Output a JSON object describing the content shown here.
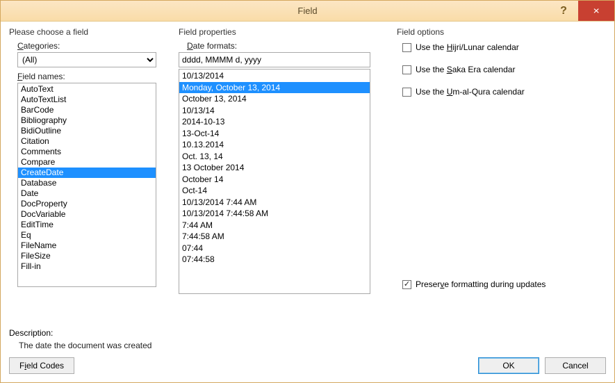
{
  "window": {
    "title": "Field"
  },
  "left": {
    "group_label": "Please choose a field",
    "categories_label_pre": "",
    "categories_label": "Categories:",
    "categories_accel": "C",
    "category_selected": "(All)",
    "fieldnames_label": "Field names:",
    "fieldnames_accel": "F",
    "field_names": [
      "AutoText",
      "AutoTextList",
      "BarCode",
      "Bibliography",
      "BidiOutline",
      "Citation",
      "Comments",
      "Compare",
      "CreateDate",
      "Database",
      "Date",
      "DocProperty",
      "DocVariable",
      "EditTime",
      "Eq",
      "FileName",
      "FileSize",
      "Fill-in"
    ],
    "field_selected_index": 8
  },
  "mid": {
    "group_label": "Field properties",
    "formats_label": "Date formats:",
    "formats_accel": "D",
    "format_input": "dddd, MMMM d, yyyy",
    "formats": [
      "10/13/2014",
      "Monday, October 13, 2014",
      "October 13, 2014",
      "10/13/14",
      "2014-10-13",
      "13-Oct-14",
      "10.13.2014",
      "Oct. 13, 14",
      "13 October 2014",
      "October 14",
      "Oct-14",
      "10/13/2014 7:44 AM",
      "10/13/2014 7:44:58 AM",
      "7:44 AM",
      "7:44:58 AM",
      "07:44",
      "07:44:58"
    ],
    "format_selected_index": 1
  },
  "right": {
    "group_label": "Field options",
    "opt_hijri": "Use the Hijri/Lunar calendar",
    "opt_hijri_accel": "H",
    "opt_saka": "Use the Saka Era calendar",
    "opt_saka_accel": "S",
    "opt_umalqura": "Use the Um-al-Qura calendar",
    "opt_umalqura_accel": "U",
    "opt_preserve": "Preserve formatting during updates",
    "opt_preserve_accel": "V",
    "preserve_checked": true
  },
  "desc": {
    "label": "Description:",
    "text": "The date the document was created"
  },
  "footer": {
    "field_codes": "Field Codes",
    "field_codes_accel": "I",
    "ok": "OK",
    "cancel": "Cancel"
  }
}
